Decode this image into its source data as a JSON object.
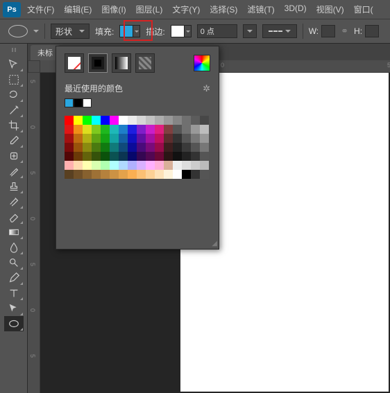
{
  "app": {
    "logo": "Ps"
  },
  "menu": [
    "文件(F)",
    "编辑(E)",
    "图像(I)",
    "图层(L)",
    "文字(Y)",
    "选择(S)",
    "滤镜(T)",
    "3D(D)",
    "视图(V)",
    "窗口("
  ],
  "options": {
    "shape_label": "形状",
    "fill_label": "填充:",
    "fill_color": "#2aa7e0",
    "stroke_label": "描边:",
    "stroke_color": "#ffffff",
    "stroke_width": "0 点",
    "w_label": "W:",
    "h_label": "H:"
  },
  "tab": {
    "label": "未标"
  },
  "ruler_h": [
    "0",
    "5"
  ],
  "ruler_v": [
    "5",
    "0",
    "5",
    "0",
    "5",
    "0",
    "5"
  ],
  "tools": [
    "move",
    "marquee",
    "lasso",
    "wand",
    "crop",
    "eyedropper",
    "heal",
    "brush",
    "stamp",
    "history",
    "eraser",
    "gradient",
    "blur",
    "dodge",
    "pen",
    "type",
    "path",
    "ellipse"
  ],
  "colorPanel": {
    "recent_title": "最近使用的颜色",
    "recent": [
      "#2aa7e0",
      "#000000",
      "#ffffff"
    ],
    "rows": [
      [
        "#ff0000",
        "#ffff00",
        "#00ff00",
        "#00ffff",
        "#0000ff",
        "#ff00ff",
        "#ffffff",
        "#ebebeb",
        "#d6d6d6",
        "#c2c2c2",
        "#adadad",
        "#999999",
        "#858585",
        "#707070",
        "#5c5c5c",
        "#474747"
      ],
      [
        "#e01717",
        "#f08f17",
        "#dede1e",
        "#7fc91e",
        "#1eb81e",
        "#1eb8b8",
        "#1e7fc9",
        "#1e1ee0",
        "#7f1ec9",
        "#c91ec9",
        "#e01e7f",
        "#804040",
        "#555",
        "#707070",
        "#999",
        "#bdbdbd"
      ],
      [
        "#a31010",
        "#bf6a10",
        "#b0b014",
        "#5fa314",
        "#14a314",
        "#14a3a3",
        "#145fa3",
        "#1010bf",
        "#5f10a3",
        "#a310a3",
        "#bf105f",
        "#5c2e2e",
        "#333",
        "#555",
        "#777",
        "#999"
      ],
      [
        "#7a0b0b",
        "#99520b",
        "#8a8a10",
        "#4a7a10",
        "#107a10",
        "#107a7a",
        "#104a7a",
        "#0b0b99",
        "#4a0b7a",
        "#7a0b7a",
        "#990b4a",
        "#3d1f1f",
        "#222",
        "#3a3a3a",
        "#555",
        "#777"
      ],
      [
        "#520707",
        "#6b3907",
        "#63630b",
        "#35520b",
        "#0b520b",
        "#0b5252",
        "#0b3552",
        "#07076b",
        "#350752",
        "#520752",
        "#6b0735",
        "#2b1515",
        "#111",
        "#222",
        "#333",
        "#555"
      ],
      [
        "#ffb0b0",
        "#ffd9b0",
        "#ffffb0",
        "#d9ffb0",
        "#b0ffb0",
        "#b0ffff",
        "#b0d9ff",
        "#b0b0ff",
        "#d9b0ff",
        "#ffb0ff",
        "#ffb0d9",
        "#d9b099",
        "#eee",
        "#ddd",
        "#ccc",
        "#bbb"
      ],
      [
        "#594021",
        "#705028",
        "#87612f",
        "#9e7136",
        "#b5813d",
        "#cc9244",
        "#e3a24b",
        "#faaf52",
        "#fbc074",
        "#fcd196",
        "#fde2b8",
        "#fef3da",
        "#fff",
        "#000",
        "#333",
        "#555"
      ]
    ]
  }
}
